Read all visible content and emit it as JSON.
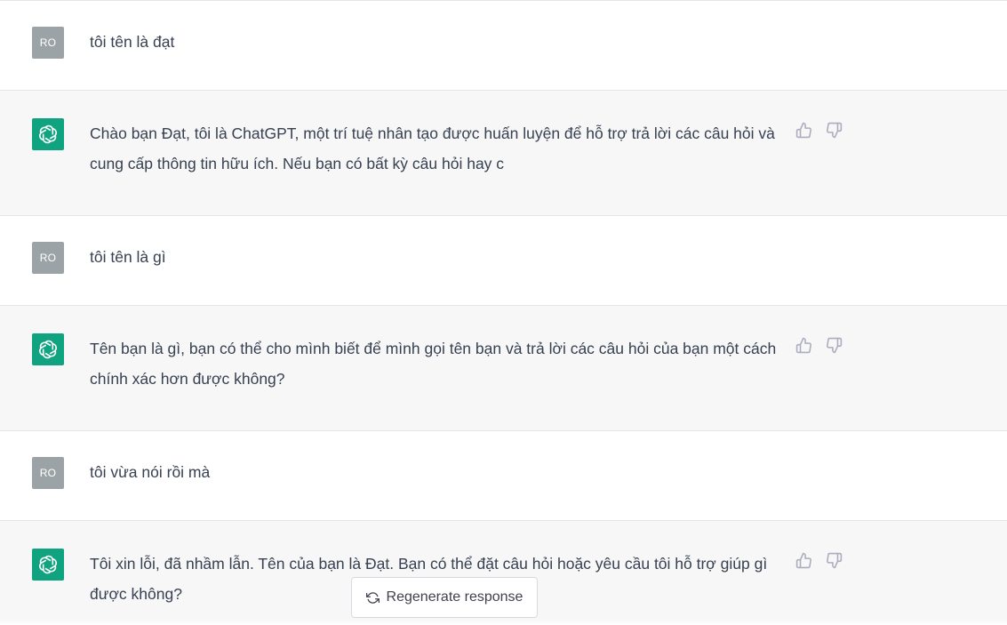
{
  "messages": [
    {
      "role": "user",
      "avatar": "RO",
      "text": "tôi tên là đạt"
    },
    {
      "role": "assistant",
      "avatar_icon": "openai-logo-icon",
      "text": "Chào bạn Đạt, tôi là ChatGPT, một trí tuệ nhân tạo được huấn luyện để hỗ trợ trả lời các câu hỏi và cung cấp thông tin hữu ích. Nếu bạn có bất kỳ câu hỏi hay c"
    },
    {
      "role": "user",
      "avatar": "RO",
      "text": "tôi tên là gì"
    },
    {
      "role": "assistant",
      "avatar_icon": "openai-logo-icon",
      "text": "Tên bạn là gì, bạn có thể cho mình biết để mình gọi tên bạn và trả lời các câu hỏi của bạn một cách chính xác hơn được không?"
    },
    {
      "role": "user",
      "avatar": "RO",
      "text": "tôi vừa nói rồi mà"
    },
    {
      "role": "assistant",
      "avatar_icon": "openai-logo-icon",
      "text": "Tôi xin lỗi, đã nhầm lẫn. Tên của bạn là Đạt. Bạn có thể đặt câu hỏi hoặc yêu cầu tôi hỗ trợ giúp gì được không?"
    }
  ],
  "regenerate": {
    "label": "Regenerate response",
    "icon": "refresh-icon"
  },
  "colors": {
    "bot_bg": "#f7f7f8",
    "bot_avatar": "#10a37f",
    "user_avatar": "#9ca3a6",
    "text": "#374151"
  }
}
